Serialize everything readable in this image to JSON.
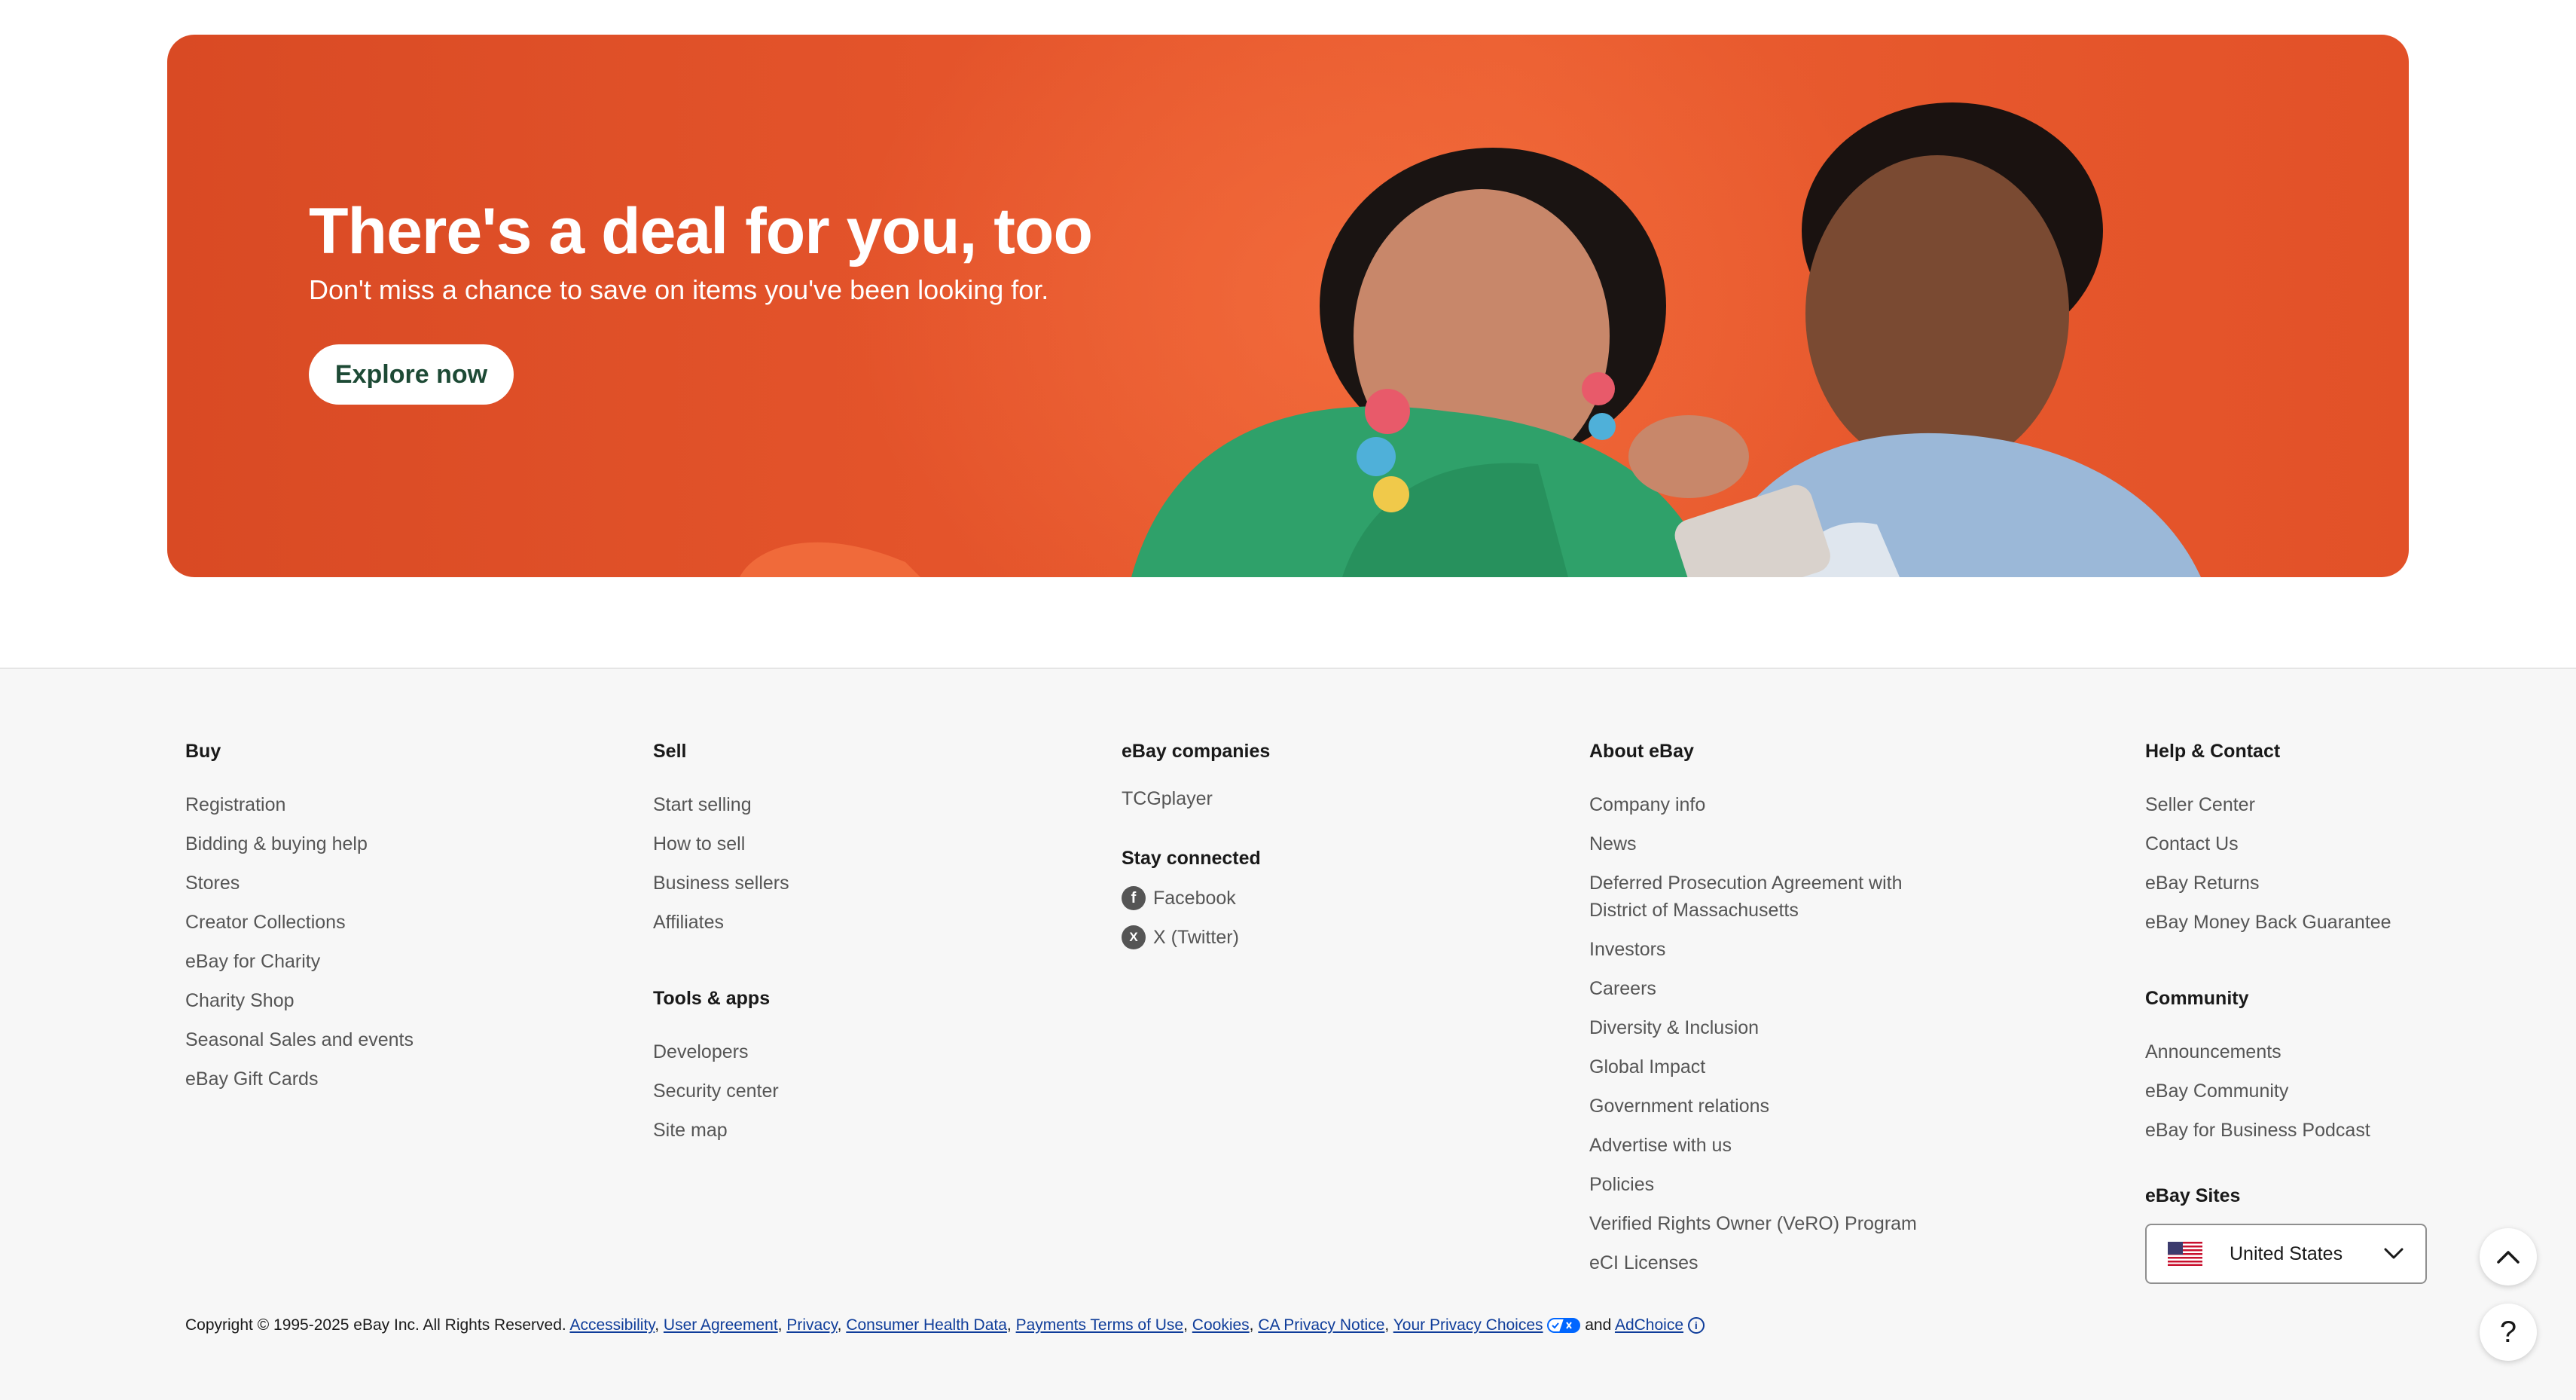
{
  "hero": {
    "title": "There's a deal for you, too",
    "subtitle": "Don't miss a chance to save on items you've been looking for.",
    "cta_label": "Explore now"
  },
  "footer": {
    "buy": {
      "heading": "Buy",
      "links": [
        "Registration",
        "Bidding & buying help",
        "Stores",
        "Creator Collections",
        "eBay for Charity",
        "Charity Shop",
        "Seasonal Sales and events",
        "eBay Gift Cards"
      ]
    },
    "sell": {
      "heading": "Sell",
      "links": [
        "Start selling",
        "How to sell",
        "Business sellers",
        "Affiliates"
      ]
    },
    "tools": {
      "heading": "Tools & apps",
      "links": [
        "Developers",
        "Security center",
        "Site map"
      ]
    },
    "companies": {
      "heading": "eBay companies",
      "links": [
        "TCGplayer"
      ]
    },
    "stay_connected": {
      "heading": "Stay connected",
      "links": [
        {
          "label": "Facebook",
          "icon": "facebook-icon"
        },
        {
          "label": "X (Twitter)",
          "icon": "x-twitter-icon"
        }
      ]
    },
    "about": {
      "heading": "About eBay",
      "links": [
        "Company info",
        "News",
        "Deferred Prosecution Agreement with District of Massachusetts",
        "Investors",
        "Careers",
        "Diversity & Inclusion",
        "Global Impact",
        "Government relations",
        "Advertise with us",
        "Policies",
        "Verified Rights Owner (VeRO) Program",
        "eCI Licenses"
      ]
    },
    "help": {
      "heading": "Help & Contact",
      "links": [
        "Seller Center",
        "Contact Us",
        "eBay Returns",
        "eBay Money Back Guarantee"
      ]
    },
    "community": {
      "heading": "Community",
      "links": [
        "Announcements",
        "eBay Community",
        "eBay for Business Podcast"
      ]
    },
    "sites": {
      "heading": "eBay Sites",
      "selected": "United States"
    },
    "copyright": {
      "text": "Copyright © 1995-2025 eBay Inc. All Rights Reserved.",
      "links": [
        "Accessibility",
        "User Agreement",
        "Privacy",
        "Consumer Health Data",
        "Payments Terms of Use",
        "Cookies",
        "CA Privacy Notice",
        "Your Privacy Choices"
      ],
      "and": "and",
      "adchoice": "AdChoice"
    }
  },
  "colors": {
    "hero_bg": "#e4542b",
    "cta_text": "#1d4a35",
    "link_blue": "#0f3d9a"
  }
}
